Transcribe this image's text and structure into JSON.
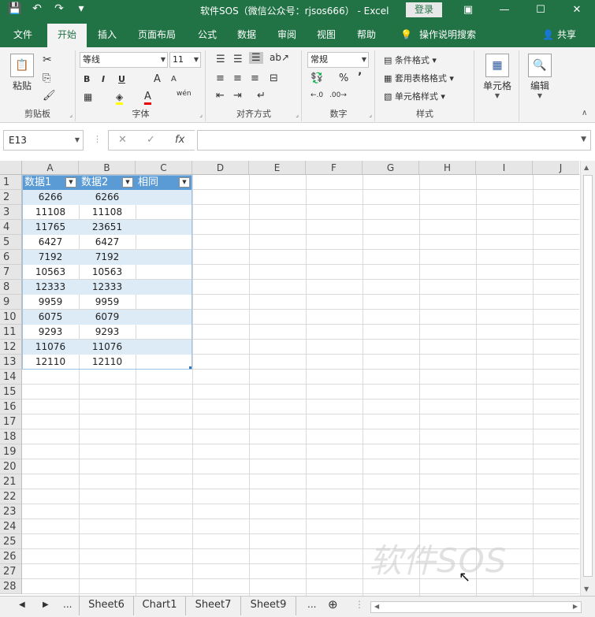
{
  "titlebar": {
    "title": "软件SOS（微信公众号：rjsos666） -  Excel",
    "login": "登录",
    "qat": {
      "save": "💾",
      "undo": "↶",
      "redo": "↷",
      "more": "▾"
    },
    "win": {
      "ribbon_opts": "▣",
      "minimize": "—",
      "restore": "☐",
      "close": "✕"
    }
  },
  "tabs": [
    "文件",
    "开始",
    "插入",
    "页面布局",
    "公式",
    "数据",
    "审阅",
    "视图",
    "帮助",
    "操作说明搜索",
    "共享"
  ],
  "ribbon": {
    "clipboard": {
      "paste": "粘贴",
      "label": "剪贴板"
    },
    "font": {
      "name": "等线",
      "size": "11",
      "bold": "B",
      "italic": "I",
      "underline": "U",
      "grow": "A",
      "shrink": "A",
      "fontcolor": "A",
      "phonetic": "wén",
      "label": "字体"
    },
    "alignment": {
      "label": "对齐方式"
    },
    "number": {
      "format": "常规",
      "percent": "%",
      "comma": "’",
      "label": "数字"
    },
    "styles": {
      "conditional": "条件格式",
      "table": "套用表格格式",
      "cell": "单元格样式",
      "label": "样式"
    },
    "cells": {
      "label": "单元格"
    },
    "editing": {
      "label": "编辑"
    }
  },
  "formula_bar": {
    "name_box": "E13",
    "fx": "fx",
    "cancel": "✕",
    "enter": "✓",
    "value": ""
  },
  "columns": [
    "A",
    "B",
    "C",
    "D",
    "E",
    "F",
    "G",
    "H",
    "I",
    "J"
  ],
  "rows": [
    "1",
    "2",
    "3",
    "4",
    "5",
    "6",
    "7",
    "8",
    "9",
    "10",
    "11",
    "12",
    "13",
    "14",
    "15",
    "16",
    "17",
    "18",
    "19",
    "20",
    "21",
    "22",
    "23",
    "24",
    "25",
    "26",
    "27",
    "28"
  ],
  "table": {
    "headers": [
      "数据1",
      "数据2",
      "相同"
    ],
    "data1": [
      "6266",
      "11108",
      "11765",
      "6427",
      "7192",
      "10563",
      "12333",
      "9959",
      "6075",
      "9293",
      "11076",
      "12110"
    ],
    "data2": [
      "6266",
      "11108",
      "23651",
      "6427",
      "7192",
      "10563",
      "12333",
      "9959",
      "6079",
      "9293",
      "11076",
      "12110"
    ]
  },
  "sheets": {
    "tabs": [
      "Sheet6",
      "Chart1",
      "Sheet7",
      "Sheet9"
    ],
    "ellipsis": "...",
    "add": "⊕"
  },
  "watermark": "软件SOS",
  "colors": {
    "excel_green": "#217346",
    "table_header": "#5b9bd5",
    "table_band": "#ddebf7"
  }
}
